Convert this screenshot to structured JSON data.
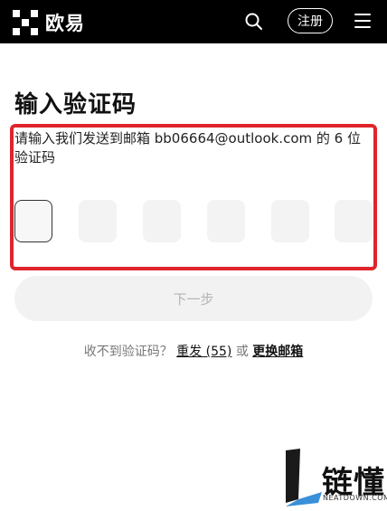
{
  "header": {
    "brand": "欧易",
    "register_label": "注册"
  },
  "page": {
    "title": "输入验证码",
    "description": "请输入我们发送到邮箱 bb06664@outlook.com 的 6 位验证码"
  },
  "code_inputs": [
    "",
    "",
    "",
    "",
    "",
    ""
  ],
  "actions": {
    "next_label": "下一步",
    "no_code_prompt": "收不到验证码？",
    "resend_label": "重发 (55)",
    "or_label": "或",
    "change_email_label": "更换邮箱"
  },
  "watermark": {
    "text": "链懂",
    "subtext": "NEATDOWN.COM"
  },
  "colors": {
    "header_bg": "#000000",
    "highlight_border": "#e0242b",
    "disabled_button": "#f2f2f2"
  }
}
